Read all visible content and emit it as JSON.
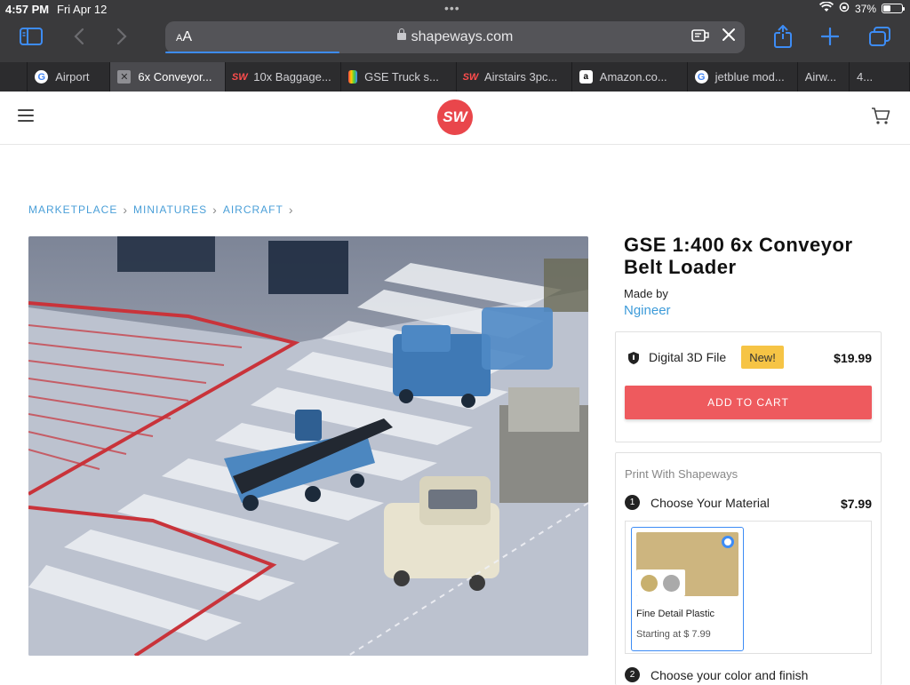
{
  "status": {
    "time": "4:57 PM",
    "date": "Fri Apr 12",
    "battery": "37%",
    "dots": "•••"
  },
  "browser": {
    "text_size_label": "AA",
    "url": "shapeways.com",
    "load_progress": 0.3,
    "accent": "#3d8cf5",
    "tabs": [
      {
        "favicon": "google",
        "label": "Airport",
        "active": false
      },
      {
        "favicon": "close",
        "label": "6x Conveyor...",
        "active": true
      },
      {
        "favicon": "shapeways",
        "label": "10x Baggage...",
        "active": false
      },
      {
        "favicon": "gse",
        "label": "GSE Truck s...",
        "active": false
      },
      {
        "favicon": "shapeways",
        "label": "Airstairs 3pc...",
        "active": false
      },
      {
        "favicon": "amazon",
        "label": "Amazon.co...",
        "active": false
      },
      {
        "favicon": "google",
        "label": "jetblue mod...",
        "active": false
      },
      {
        "favicon": "none",
        "label": "Airw...",
        "active": false
      },
      {
        "favicon": "none",
        "label": "4...",
        "active": false
      }
    ]
  },
  "site": {
    "logo_text": "SW",
    "brand_color": "#e9464b",
    "breadcrumb": [
      "MARKETPLACE",
      "MINIATURES",
      "AIRCRAFT"
    ]
  },
  "product": {
    "title": "GSE 1:400 6x Conveyor Belt Loader",
    "made_by_label": "Made by",
    "maker": "Ngineer",
    "image_alt": "1:400 scale airport ground service equipment models on an apron mat"
  },
  "digital": {
    "label": "Digital 3D File",
    "badge": "New!",
    "price": "$19.99",
    "add_to_cart": "ADD TO CART"
  },
  "print": {
    "heading": "Print With Shapeways",
    "step1_num": "1",
    "step1_label": "Choose Your Material",
    "step1_price": "$7.99",
    "material": {
      "name": "Fine Detail Plastic",
      "starting": "Starting at $ 7.99",
      "swatch_color": "#cdb57f",
      "chip_colors": [
        "#c8b06e",
        "#aaaaaa"
      ]
    },
    "step2_num": "2",
    "step2_label": "Choose your color and finish"
  }
}
